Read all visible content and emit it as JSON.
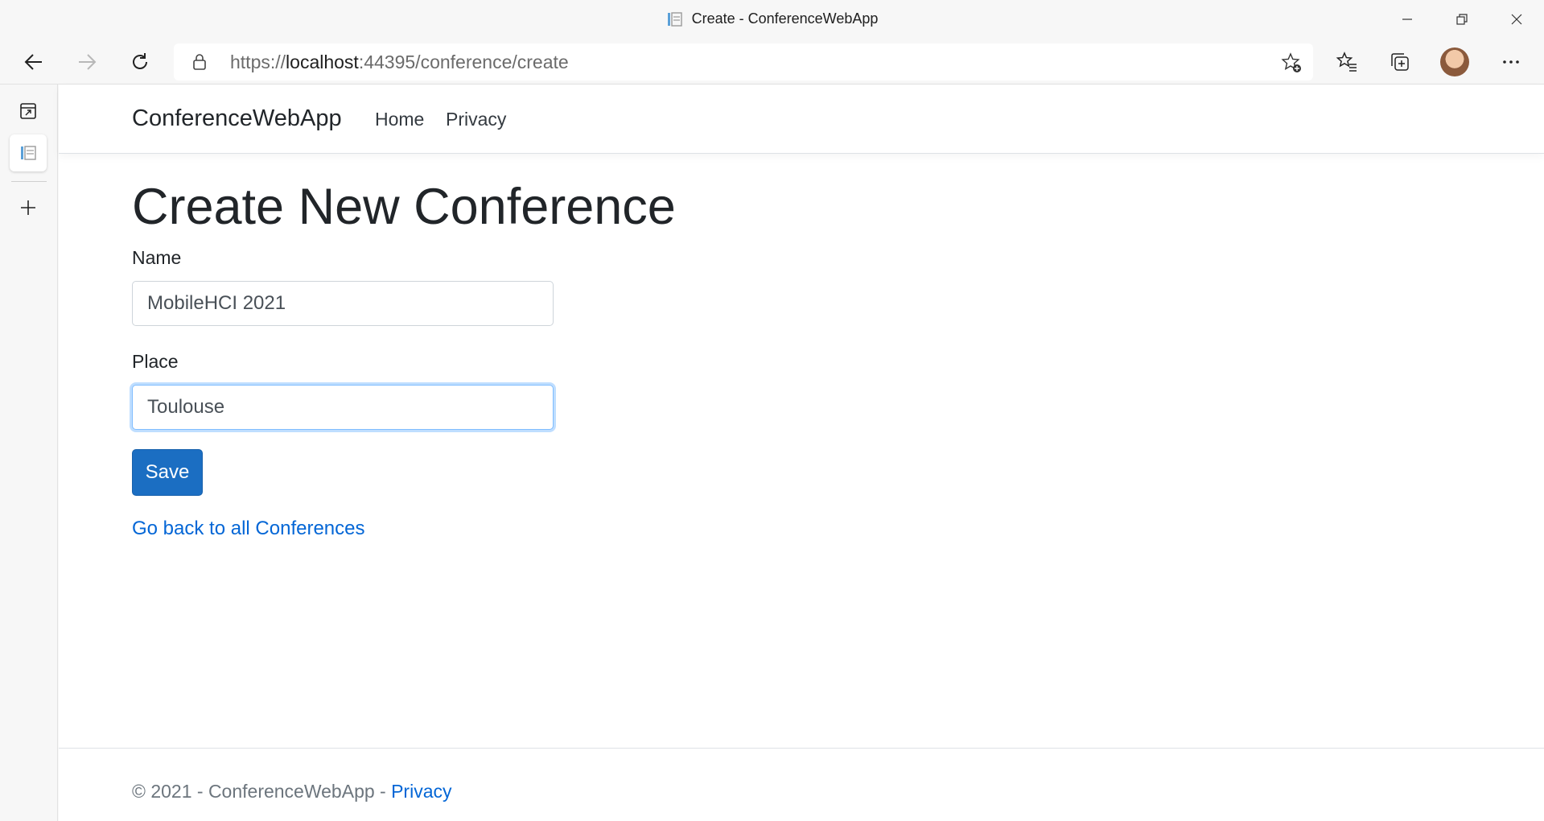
{
  "browser": {
    "window_title": "Create - ConferenceWebApp",
    "url": {
      "scheme": "https://",
      "host": "localhost",
      "port_path": ":44395/conference/create"
    },
    "icons": {
      "back": "arrow-left-icon",
      "forward": "arrow-right-icon",
      "refresh": "refresh-icon",
      "lock": "lock-icon",
      "add_favorite": "star-plus-icon",
      "favorites": "favorites-list-icon",
      "collections": "collections-icon",
      "profile": "avatar",
      "more": "more-dots-icon"
    }
  },
  "app": {
    "brand": "ConferenceWebApp",
    "nav": [
      {
        "label": "Home"
      },
      {
        "label": "Privacy"
      }
    ]
  },
  "form": {
    "heading": "Create New Conference",
    "name_label": "Name",
    "name_value": "MobileHCI 2021",
    "place_label": "Place",
    "place_value": "Toulouse",
    "save_label": "Save",
    "back_link": "Go back to all Conferences"
  },
  "footer": {
    "text": "© 2021 - ConferenceWebApp - ",
    "link": "Privacy"
  },
  "colors": {
    "primary_button": "#1b6ec2",
    "link": "#0366d6",
    "focus_border": "#80bdff"
  }
}
